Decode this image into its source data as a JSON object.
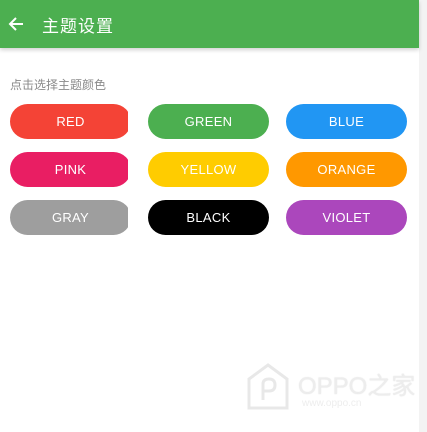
{
  "app_bar": {
    "title": "主题设置",
    "back_icon": "arrow-left-icon",
    "background": "#4caf50"
  },
  "hint": "点击选择主题颜色",
  "colors": [
    {
      "label": "RED",
      "bg": "#f44336",
      "fg": "#ffffff"
    },
    {
      "label": "GREEN",
      "bg": "#4caf50",
      "fg": "#ffffff"
    },
    {
      "label": "BLUE",
      "bg": "#2196f3",
      "fg": "#ffffff"
    },
    {
      "label": "PINK",
      "bg": "#e91e63",
      "fg": "#ffffff"
    },
    {
      "label": "YELLOW",
      "bg": "#ffcc00",
      "fg": "#ffffff"
    },
    {
      "label": "ORANGE",
      "bg": "#ff9800",
      "fg": "#ffffff"
    },
    {
      "label": "GRAY",
      "bg": "#9e9e9e",
      "fg": "#ffffff"
    },
    {
      "label": "BLACK",
      "bg": "#000000",
      "fg": "#ffffff"
    },
    {
      "label": "VIOLET",
      "bg": "#ab47bc",
      "fg": "#ffffff"
    }
  ],
  "watermark": {
    "brand": "OPPO之家",
    "url": "www.oppo.cn"
  }
}
